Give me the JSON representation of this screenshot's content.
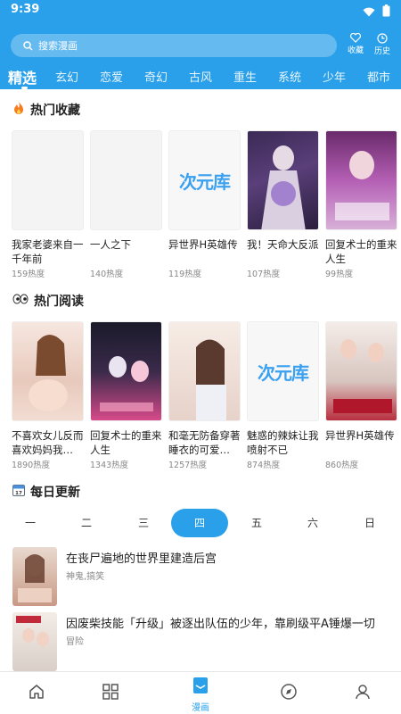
{
  "status": {
    "time": "9:39"
  },
  "search": {
    "placeholder": "搜索漫画"
  },
  "header_buttons": {
    "favorites": "收藏",
    "history": "历史"
  },
  "tabs": [
    "精选",
    "玄幻",
    "恋爱",
    "奇幻",
    "古风",
    "重生",
    "系统",
    "少年",
    "都市"
  ],
  "active_tab": "精选",
  "sections": {
    "hot_favorites": {
      "title": "热门收藏",
      "items": [
        {
          "title": "我家老婆来自一千年前",
          "heat": "159热度"
        },
        {
          "title": "一人之下",
          "heat": "140热度"
        },
        {
          "title": "异世界H英雄传",
          "heat": "119热度"
        },
        {
          "title": "我！天命大反派",
          "heat": "107热度"
        },
        {
          "title": "回复术士的重来人生",
          "heat": "99热度"
        }
      ]
    },
    "hot_reading": {
      "title": "热门阅读",
      "items": [
        {
          "title": "不喜欢女儿反而喜欢妈妈我…",
          "heat": "1890热度"
        },
        {
          "title": "回复术士的重来人生",
          "heat": "1343热度"
        },
        {
          "title": "和毫无防备穿著睡衣的可爱…",
          "heat": "1257热度"
        },
        {
          "title": "魅惑的辣妹让我喷射不已",
          "heat": "874热度"
        },
        {
          "title": "异世界H英雄传",
          "heat": "860热度"
        }
      ]
    },
    "daily_update": {
      "title": "每日更新",
      "weekdays": [
        "一",
        "二",
        "三",
        "四",
        "五",
        "六",
        "日"
      ],
      "active_weekday": "四",
      "items": [
        {
          "title": "在丧尸遍地的世界里建造后宫",
          "tags": "神鬼,搞笑"
        },
        {
          "title": "因废柴技能「升级」被逐出队伍的少年，靠刷级平A锤爆一切",
          "tags": "冒险"
        }
      ]
    }
  },
  "placeholder_logo": {
    "text": "次元库"
  },
  "bottom_nav": {
    "active_label": "漫画"
  },
  "colors": {
    "primary": "#2aa0ea",
    "text": "#222222",
    "muted": "#888888"
  }
}
